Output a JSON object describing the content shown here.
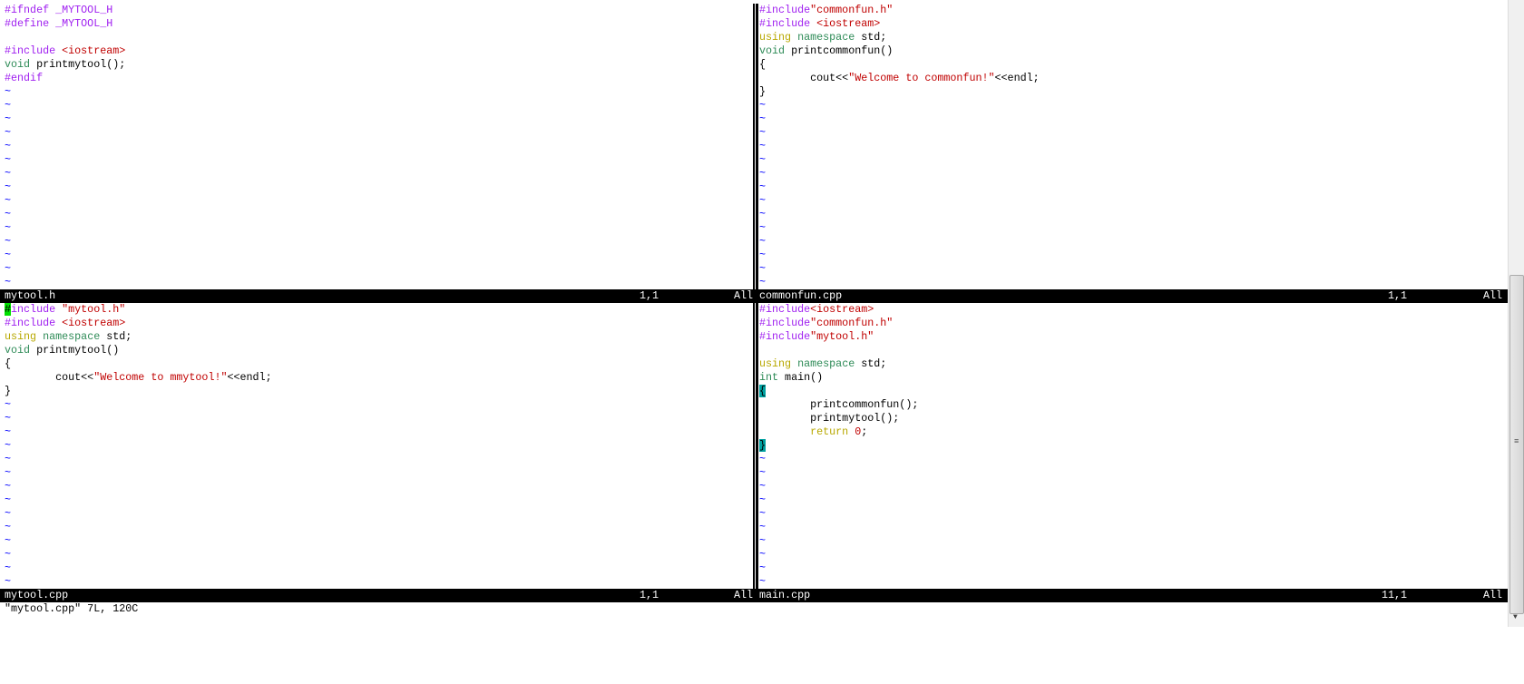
{
  "colors": {
    "preproc": "#a020f0",
    "string": "#c00000",
    "type": "#2e8b57",
    "statement": "#b8a800",
    "tilde": "#0000ff",
    "cursor": "#00e000",
    "match_paren": "#00a0a0"
  },
  "panes": [
    {
      "file": "mytool.h",
      "position": "1,1",
      "scroll": "All",
      "lines": [
        [
          [
            "#ifndef _MYTOOL_H",
            "pp"
          ]
        ],
        [
          [
            "#define _MYTOOL_H",
            "pp"
          ]
        ],
        [],
        [
          [
            "#include ",
            "pp"
          ],
          [
            "<iostream>",
            "str"
          ]
        ],
        [
          [
            "void",
            "ty"
          ],
          [
            " printmytool();",
            ""
          ]
        ],
        [
          [
            "#endif",
            "pp"
          ]
        ]
      ],
      "tildes": 15
    },
    {
      "file": "commonfun.cpp",
      "position": "1,1",
      "scroll": "All",
      "lines": [
        [
          [
            "#include",
            "pp"
          ],
          [
            "\"commonfun.h\"",
            "str"
          ]
        ],
        [
          [
            "#include ",
            "pp"
          ],
          [
            "<iostream>",
            "str"
          ]
        ],
        [
          [
            "using",
            "st"
          ],
          [
            " ",
            ""
          ],
          [
            "namespace",
            "ty"
          ],
          [
            " std;",
            ""
          ]
        ],
        [
          [
            "void",
            "ty"
          ],
          [
            " printcommonfun()",
            ""
          ]
        ],
        [
          [
            "{",
            ""
          ]
        ],
        [
          [
            "        cout<<",
            ""
          ],
          [
            "\"Welcome to commonfun!\"",
            "str"
          ],
          [
            "<<endl;",
            ""
          ]
        ],
        [
          [
            "}",
            ""
          ]
        ]
      ],
      "tildes": 14
    },
    {
      "file": "mytool.cpp",
      "position": "1,1",
      "scroll": "All",
      "lines": [
        [
          [
            "#",
            "pp cur"
          ],
          [
            "include ",
            "pp"
          ],
          [
            "\"mytool.h\"",
            "str"
          ]
        ],
        [
          [
            "#include ",
            "pp"
          ],
          [
            "<iostream>",
            "str"
          ]
        ],
        [
          [
            "using",
            "st"
          ],
          [
            " ",
            ""
          ],
          [
            "namespace",
            "ty"
          ],
          [
            " std;",
            ""
          ]
        ],
        [
          [
            "void",
            "ty"
          ],
          [
            " printmytool()",
            ""
          ]
        ],
        [
          [
            "{",
            ""
          ]
        ],
        [
          [
            "        cout<<",
            ""
          ],
          [
            "\"Welcome to mmytool!\"",
            "str"
          ],
          [
            "<<endl;",
            ""
          ]
        ],
        [
          [
            "}",
            ""
          ]
        ]
      ],
      "tildes": 14
    },
    {
      "file": "main.cpp",
      "position": "11,1",
      "scroll": "All",
      "lines": [
        [
          [
            "#include",
            "pp"
          ],
          [
            "<iostream>",
            "str"
          ]
        ],
        [
          [
            "#include",
            "pp"
          ],
          [
            "\"commonfun.h\"",
            "str"
          ]
        ],
        [
          [
            "#include",
            "pp"
          ],
          [
            "\"mytool.h\"",
            "str"
          ]
        ],
        [],
        [
          [
            "using",
            "st"
          ],
          [
            " ",
            ""
          ],
          [
            "namespace",
            "ty"
          ],
          [
            " std;",
            ""
          ]
        ],
        [
          [
            "int",
            "ty"
          ],
          [
            " main()",
            ""
          ]
        ],
        [
          [
            "{",
            "match"
          ]
        ],
        [
          [
            "        printcommonfun();",
            ""
          ]
        ],
        [
          [
            "        printmytool();",
            ""
          ]
        ],
        [
          [
            "        ",
            ""
          ],
          [
            "return",
            "st"
          ],
          [
            " ",
            ""
          ],
          [
            "0",
            "num"
          ],
          [
            ";",
            ""
          ]
        ],
        [
          [
            "}",
            "match"
          ]
        ]
      ],
      "tildes": 10
    }
  ],
  "tilde_char": "~",
  "command_line": "\"mytool.cpp\" 7L, 120C"
}
